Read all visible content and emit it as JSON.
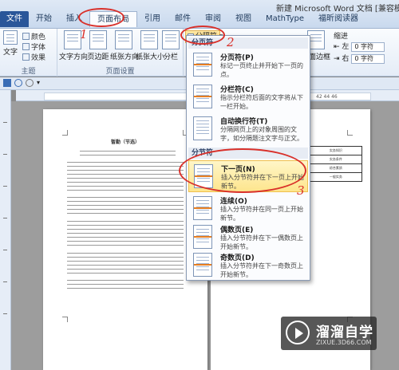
{
  "window": {
    "title": "新建 Microsoft Word 文档 [兼容模式"
  },
  "tabs": [
    "文件",
    "开始",
    "插入",
    "页面布局",
    "引用",
    "邮件",
    "审阅",
    "视图",
    "MathType",
    "福昕阅读器"
  ],
  "ribbon": {
    "theme_group": {
      "themes_label": "文字",
      "colors_label": "颜色",
      "fonts_label": "字体",
      "effects_label": "效果",
      "title": "主题"
    },
    "page_setup": {
      "buttons": [
        "文字方向",
        "页边距",
        "纸张方向",
        "纸张大小",
        "分栏"
      ],
      "title": "页面设置"
    },
    "breaks_button": "分隔符",
    "page_border_label": "页面边框",
    "indent": {
      "label": "缩进",
      "left_label": "左",
      "right_label": "右",
      "left_value": "0 字符",
      "right_value": "0 字符"
    }
  },
  "ruler": {
    "numbers": "42 44 46"
  },
  "menu": {
    "section_page_breaks": "分页符",
    "section_section_breaks": "分节符",
    "items": [
      {
        "title": "分页符(P)",
        "desc": "标记一页终止并开始下一页的点。"
      },
      {
        "title": "分栏符(C)",
        "desc": "指示分栏符后面的文字将从下一栏开始。"
      },
      {
        "title": "自动换行符(T)",
        "desc": "分隔网页上的对象周围的文字，如分隔题注文字与正文。"
      },
      {
        "title": "下一页(N)",
        "desc": "插入分节符并在下一页上开始新节。"
      },
      {
        "title": "连续(O)",
        "desc": "插入分节符并在同一页上开始新节。"
      },
      {
        "title": "偶数页(E)",
        "desc": "插入分节符并在下一偶数页上开始新节。"
      },
      {
        "title": "奇数页(D)",
        "desc": "插入分节符并在下一奇数页上开始新节。"
      }
    ]
  },
  "document": {
    "page1_heading": "暂勤（节选）",
    "table_cells": [
      "",
      "实务知识",
      "",
      "实务条件",
      "",
      "综合素质",
      "",
      "一般实务"
    ]
  },
  "annotations": {
    "mark1": "1",
    "mark2": "2",
    "mark3": "3"
  },
  "watermark": {
    "cn": "溜溜自学",
    "en": "ZIXUE.3D66.COM"
  },
  "colors": {
    "accent_tab": "#2a5699",
    "highlight": "#fde58d",
    "annotation": "#d9302a"
  }
}
